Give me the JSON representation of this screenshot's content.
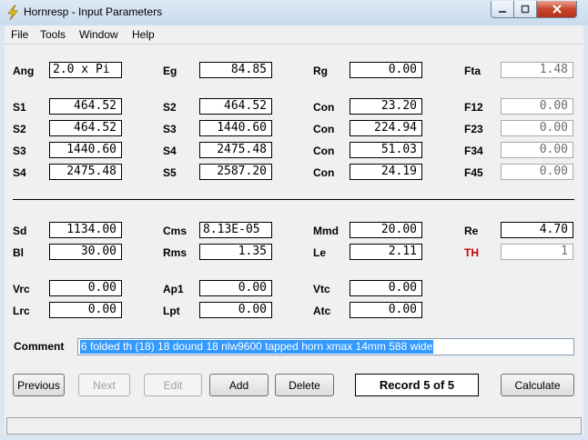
{
  "window": {
    "title": "Hornresp - Input Parameters"
  },
  "menu": [
    "File",
    "Tools",
    "Window",
    "Help"
  ],
  "params": {
    "Ang": {
      "label": "Ang",
      "value": "2.0 x Pi"
    },
    "Eg": {
      "label": "Eg",
      "value": "84.85"
    },
    "Rg": {
      "label": "Rg",
      "value": "0.00"
    },
    "Fta": {
      "label": "Fta",
      "value": "1.48"
    },
    "row_s1": {
      "label1": "S1",
      "value1": "464.52",
      "label2": "S2",
      "value2": "464.52",
      "label3": "Con",
      "value3": "23.20",
      "label4": "F12",
      "value4": "0.00"
    },
    "row_s2": {
      "label1": "S2",
      "value1": "464.52",
      "label2": "S3",
      "value2": "1440.60",
      "label3": "Con",
      "value3": "224.94",
      "label4": "F23",
      "value4": "0.00"
    },
    "row_s3": {
      "label1": "S3",
      "value1": "1440.60",
      "label2": "S4",
      "value2": "2475.48",
      "label3": "Con",
      "value3": "51.03",
      "label4": "F34",
      "value4": "0.00"
    },
    "row_s4": {
      "label1": "S4",
      "value1": "2475.48",
      "label2": "S5",
      "value2": "2587.20",
      "label3": "Con",
      "value3": "24.19",
      "label4": "F45",
      "value4": "0.00"
    },
    "row_sd": {
      "label1": "Sd",
      "value1": "1134.00",
      "label2": "Cms",
      "value2": "8.13E-05",
      "label3": "Mmd",
      "value3": "20.00",
      "label4": "Re",
      "value4": "4.70"
    },
    "row_bl": {
      "label1": "Bl",
      "value1": "30.00",
      "label2": "Rms",
      "value2": "1.35",
      "label3": "Le",
      "value3": "2.11",
      "label4": "TH",
      "value4": "1"
    },
    "row_vrc": {
      "label1": "Vrc",
      "value1": "0.00",
      "label2": "Ap1",
      "value2": "0.00",
      "label3": "Vtc",
      "value3": "0.00"
    },
    "row_lrc": {
      "label1": "Lrc",
      "value1": "0.00",
      "label2": "Lpt",
      "value2": "0.00",
      "label3": "Atc",
      "value3": "0.00"
    }
  },
  "comment": {
    "label": "Comment",
    "value": "6 folded th (18) 18 dound 18 nlw9600 tapped horn xmax 14mm 588 wide"
  },
  "buttons": {
    "previous": "Previous",
    "next": "Next",
    "edit": "Edit",
    "add": "Add",
    "delete": "Delete",
    "calculate": "Calculate"
  },
  "record": "Record 5 of 5",
  "colors": {
    "th_label": "#cc0000",
    "selection": "#3399ff"
  }
}
